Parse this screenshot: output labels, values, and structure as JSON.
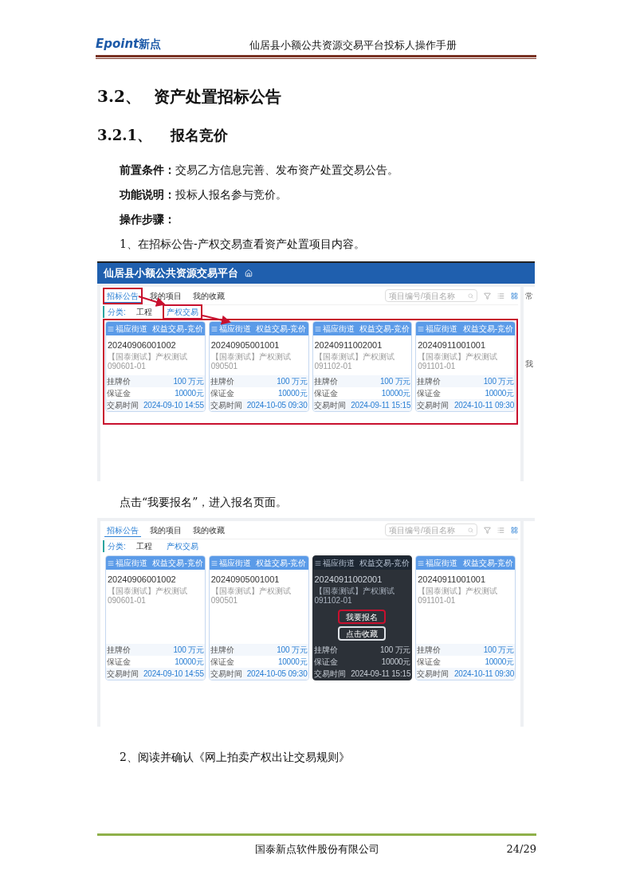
{
  "header": {
    "logo": {
      "brand": "Epoint",
      "brand_cn": "新点"
    },
    "title": "仙居县小额公共资源交易平台投标人操作手册"
  },
  "section": {
    "number": "3.2、",
    "title": "资产处置招标公告"
  },
  "subsection": {
    "number": "3.2.1、",
    "title": "报名竞价"
  },
  "paragraphs": [
    {
      "label": "前置条件：",
      "text": "交易乙方信息完善、发布资产处置交易公告。"
    },
    {
      "label": "功能说明：",
      "text": "投标人报名参与竞价。"
    },
    {
      "label": "操作步骤："
    }
  ],
  "step_1": "1、在招标公告-产权交易查看资产处置项目内容。",
  "screenshot_1": {
    "title_bar": {
      "title": "仙居县小额公共资源交易平台"
    },
    "tabs": [
      {
        "label": "招标公告",
        "selected": true,
        "highlighted": true
      },
      {
        "label": "我的项目",
        "selected": false,
        "highlighted": false
      },
      {
        "label": "我的收藏",
        "selected": false,
        "highlighted": false
      }
    ],
    "search": {
      "placeholder": "项目编号/项目名称"
    },
    "category_label": "分类:",
    "categories": [
      {
        "label": "工程",
        "selected": false,
        "highlighted": false
      },
      {
        "label": "产权交易",
        "selected": true,
        "highlighted": true
      }
    ],
    "cards_highlighted": true,
    "cards": [
      {
        "district": "福应街道",
        "type": "权益交易-竞价",
        "code": "20240906001002",
        "name": "【国泰测试】产权测试090601-01",
        "rows": [
          {
            "label": "挂牌价",
            "value": "100 万元"
          },
          {
            "label": "保证金",
            "value": "10000元"
          },
          {
            "label": "交易时间",
            "value": "2024-09-10 14:55"
          }
        ],
        "hovered": false
      },
      {
        "district": "福应街道",
        "type": "权益交易-竞价",
        "code": "20240905001001",
        "name": "【国泰测试】产权测试090501",
        "rows": [
          {
            "label": "挂牌价",
            "value": "100 万元"
          },
          {
            "label": "保证金",
            "value": "10000元"
          },
          {
            "label": "交易时间",
            "value": "2024-10-05 09:30"
          }
        ],
        "hovered": false
      },
      {
        "district": "福应街道",
        "type": "权益交易-竞价",
        "code": "20240911002001",
        "name": "【国泰测试】产权测试091102-01",
        "rows": [
          {
            "label": "挂牌价",
            "value": "100 万元"
          },
          {
            "label": "保证金",
            "value": "10000元"
          },
          {
            "label": "交易时间",
            "value": "2024-09-11 15:15"
          }
        ],
        "hovered": false
      },
      {
        "district": "福应街道",
        "type": "权益交易-竞价",
        "code": "20240911001001",
        "name": "【国泰测试】产权测试091101-01",
        "rows": [
          {
            "label": "挂牌价",
            "value": "100 万元"
          },
          {
            "label": "保证金",
            "value": "10000元"
          },
          {
            "label": "交易时间",
            "value": "2024-10-11 09:30"
          }
        ],
        "hovered": false
      }
    ],
    "right_panel": {
      "headings": [
        "常",
        "我"
      ]
    }
  },
  "caption": "点击“我要报名”，进入报名页面。",
  "screenshot_2": {
    "tabs": [
      {
        "label": "招标公告",
        "selected": true,
        "highlighted": false
      },
      {
        "label": "我的项目",
        "selected": false,
        "highlighted": false
      },
      {
        "label": "我的收藏",
        "selected": false,
        "highlighted": false
      }
    ],
    "search": {
      "placeholder": "项目编号/项目名称"
    },
    "category_label": "分类:",
    "categories": [
      {
        "label": "工程",
        "selected": false,
        "highlighted": false
      },
      {
        "label": "产权交易",
        "selected": true,
        "highlighted": false
      }
    ],
    "cards_highlighted": false,
    "cards": [
      {
        "district": "福应街道",
        "type": "权益交易-竞价",
        "code": "20240906001002",
        "name": "【国泰测试】产权测试090601-01",
        "rows": [
          {
            "label": "挂牌价",
            "value": "100 万元"
          },
          {
            "label": "保证金",
            "value": "10000元"
          },
          {
            "label": "交易时间",
            "value": "2024-09-10 14:55"
          }
        ],
        "hovered": false
      },
      {
        "district": "福应街道",
        "type": "权益交易-竞价",
        "code": "20240905001001",
        "name": "【国泰测试】产权测试090501",
        "rows": [
          {
            "label": "挂牌价",
            "value": "100 万元"
          },
          {
            "label": "保证金",
            "value": "10000元"
          },
          {
            "label": "交易时间",
            "value": "2024-10-05 09:30"
          }
        ],
        "hovered": false
      },
      {
        "district": "福应街道",
        "type": "权益交易-竞价",
        "code": "20240911002001",
        "name": "【国泰测试】产权测试091102-01",
        "rows": [
          {
            "label": "挂牌价",
            "value": "100 万元"
          },
          {
            "label": "保证金",
            "value": "10000元"
          },
          {
            "label": "交易时间",
            "value": "2024-09-11 15:15"
          }
        ],
        "hovered": true,
        "actions": [
          {
            "label": "我要报名",
            "highlighted": true
          },
          {
            "label": "点击收藏",
            "highlighted": false
          }
        ]
      },
      {
        "district": "福应街道",
        "type": "权益交易-竞价",
        "code": "20240911001001",
        "name": "【国泰测试】产权测试091101-01",
        "rows": [
          {
            "label": "挂牌价",
            "value": "100 万元"
          },
          {
            "label": "保证金",
            "value": "10000元"
          },
          {
            "label": "交易时间",
            "value": "2024-10-11 09:30"
          }
        ],
        "hovered": false
      }
    ]
  },
  "step_2": "2、阅读并确认《网上拍卖产权出让交易规则》",
  "footer": {
    "company": "国泰新点软件股份有限公司",
    "page": "24/29"
  }
}
